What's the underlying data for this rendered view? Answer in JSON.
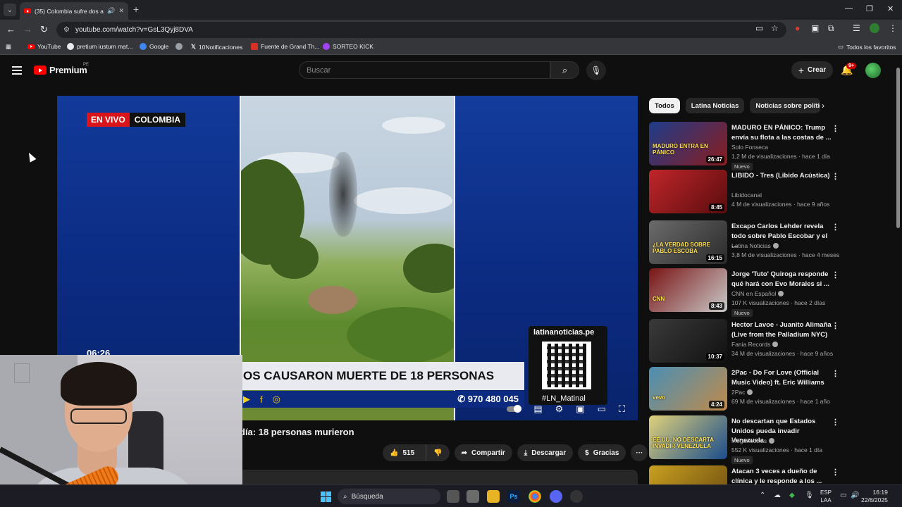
{
  "browser": {
    "tab_title": "(35) Colombia sufre dos ata",
    "url": "youtube.com/watch?v=GsL3Qyj8DVA",
    "bookmarks": [
      {
        "label": "YouTube",
        "color": "#ff0000"
      },
      {
        "label": "pretium iustum mat...",
        "color": "#e8eaed"
      },
      {
        "label": "Google",
        "color": "#4285f4"
      },
      {
        "label": "",
        "color": "#9aa0a6"
      },
      {
        "label": "10Notificaciones",
        "color": "#000000"
      },
      {
        "label": "Fuente de Grand Th...",
        "color": "#d93025"
      },
      {
        "label": "SORTEO KICK",
        "color": "#a142f4"
      }
    ],
    "all_favorites": "Todos los favoritos"
  },
  "yt": {
    "logo_text": "Premium",
    "country": "PE",
    "search_placeholder": "Buscar",
    "create_label": "Crear",
    "notif_count": "9+"
  },
  "player": {
    "live_label": "EN VIVO",
    "country_label": "COLOMBIA",
    "clock": "06:26",
    "headline": "OS CAUSARON MUERTE DE 18 PERSONAS",
    "phone": "970 480 045",
    "qr_url": "latinanoticias.pe",
    "qr_handle": "#LN_Matinal"
  },
  "video": {
    "title": "día: 18 personas murieron",
    "likes": "515",
    "share": "Compartir",
    "download": "Descargar",
    "thanks": "Gracias"
  },
  "chips": [
    "Todos",
    "Latina Noticias",
    "Noticias sobre política"
  ],
  "recs": [
    {
      "title": "MADURO EN PÁNICO: Trump envía su flota a las costas de ...",
      "channel": "Solo Fonseca",
      "meta": "1,2 M de visualizaciones · hace 1 día",
      "badge": "Nuevo",
      "dur": "26:47",
      "verified": false,
      "thumb_text": "MADURO ENTRA EN PÁNICO",
      "c1": "#1e3c8c",
      "c2": "#8a1c1c"
    },
    {
      "title": "LIBIDO - Tres (Libido Acústica)",
      "channel": "Libidocanal",
      "meta": "4 M de visualizaciones · hace 9 años",
      "badge": "",
      "dur": "8:45",
      "verified": false,
      "thumb_text": "",
      "c1": "#c0262a",
      "c2": "#5a0c0e"
    },
    {
      "title": "Excapo Carlos Lehder revela todo sobre Pablo Escobar y el ...",
      "channel": "Latina Noticias",
      "meta": "3,8 M de visualizaciones · hace 4 meses",
      "badge": "",
      "dur": "16:15",
      "verified": true,
      "thumb_text": "¿LA VERDAD SOBRE PABLO ESCOBA",
      "c1": "#6b6b6b",
      "c2": "#2a2a2a"
    },
    {
      "title": "Jorge 'Tuto' Quiroga responde qué hará con Evo Morales si ...",
      "channel": "CNN en Español",
      "meta": "107 K visualizaciones · hace 2 días",
      "badge": "Nuevo",
      "dur": "8:43",
      "verified": true,
      "thumb_text": "CNN",
      "c1": "#7a1414",
      "c2": "#c9c9c9"
    },
    {
      "title": "Hector Lavoe - Juanito Alimaña (Live from the Palladium NYC)",
      "channel": "Fania Records",
      "meta": "34 M de visualizaciones · hace 9 años",
      "badge": "",
      "dur": "10:37",
      "verified": true,
      "thumb_text": "",
      "c1": "#3a3a3a",
      "c2": "#111111"
    },
    {
      "title": "2Pac - Do For Love (Official Music Video) ft. Eric Williams",
      "channel": "2Pac",
      "meta": "69 M de visualizaciones · hace 1 año",
      "badge": "",
      "dur": "4:24",
      "verified": true,
      "thumb_text": "vevo",
      "c1": "#4a8fb5",
      "c2": "#c08a4a"
    },
    {
      "title": "No descartan que Estados Unidos pueda invadir Venezuela",
      "channel": "Meganoticias",
      "meta": "552 K visualizaciones · hace 1 día",
      "badge": "Nuevo",
      "dur": "",
      "verified": true,
      "thumb_text": "EE.UU. NO DESCARTA INVADIR VENEZUELA",
      "c1": "#e0d27a",
      "c2": "#1a4c8c"
    },
    {
      "title": "Atacan 3 veces a dueño de clínica y le responde a los ...",
      "channel": "",
      "meta": "",
      "badge": "",
      "dur": "",
      "verified": false,
      "thumb_text": "",
      "c1": "#c9a020",
      "c2": "#6a4a10"
    }
  ],
  "taskbar": {
    "search": "Búsqueda",
    "lang1": "ESP",
    "lang2": "LAA",
    "time": "16:19",
    "date": "22/8/2025"
  }
}
